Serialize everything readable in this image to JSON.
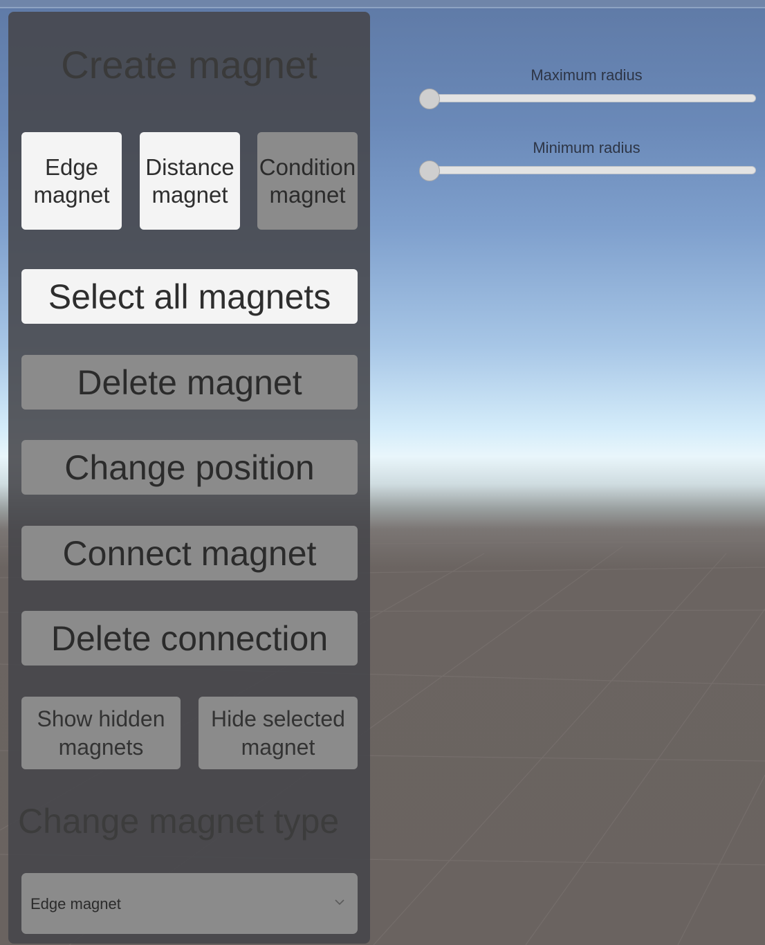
{
  "panel": {
    "title": "Create magnet",
    "magnet_buttons": [
      {
        "label": "Edge\nmagnet",
        "selected": true
      },
      {
        "label": "Distance\nmagnet",
        "selected": true
      },
      {
        "label": "Condition\nmagnet",
        "selected": false
      }
    ],
    "select_all_label": "Select all magnets",
    "delete_magnet_label": "Delete magnet",
    "change_position_label": "Change position",
    "connect_magnet_label": "Connect magnet",
    "delete_connection_label": "Delete connection",
    "show_hidden_label": "Show hidden\nmagnets",
    "hide_selected_label": "Hide selected\nmagnet",
    "change_type_title": "Change magnet type",
    "type_dropdown": {
      "selected": "Edge magnet"
    }
  },
  "sliders": {
    "maximum_radius": {
      "label": "Maximum radius",
      "value": 0.0
    },
    "minimum_radius": {
      "label": "Minimum radius",
      "value": 0.0
    }
  },
  "colors": {
    "panel_bg": "#46464a",
    "button_active": "#f4f4f4",
    "button_inactive": "#8b8b8b",
    "sky_top": "#5f7aa6",
    "horizon": "#e9f6fb",
    "ground": "#6a6360"
  },
  "icons": {
    "dropdown_chevron": "chevron-down-icon",
    "slider_handle": "circle-handle"
  }
}
